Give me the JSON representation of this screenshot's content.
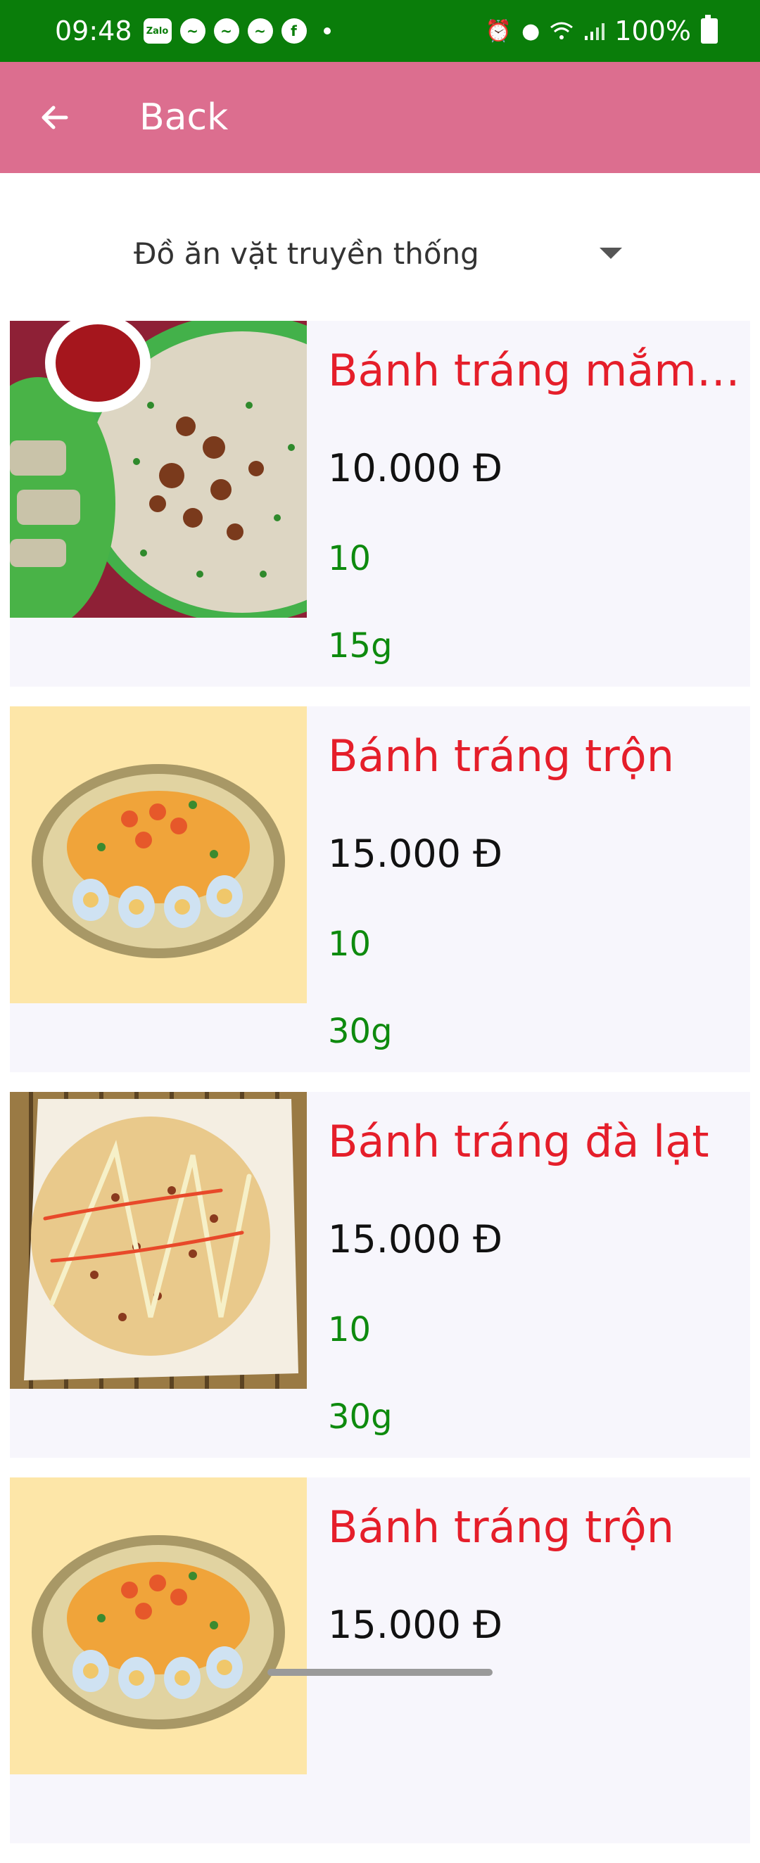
{
  "status_bar": {
    "time": "09:48",
    "notification_icons": [
      "zalo-icon",
      "messenger-icon",
      "messenger-icon",
      "messenger-icon",
      "facebook-icon",
      "more-dot-icon"
    ],
    "zalo_label": "Zalo",
    "right_icons": [
      "alarm-icon",
      "location-icon",
      "wifi-icon",
      "signal-icon",
      "battery-icon"
    ],
    "battery": "100%"
  },
  "app_bar": {
    "back_label": "Back",
    "color": "#dc6e8f"
  },
  "category_dropdown": {
    "selected": "Đồ ăn vặt truyền thống"
  },
  "products": [
    {
      "name": "Bánh tráng mắm r...",
      "price": "10.000 Đ",
      "quantity": "10",
      "weight": "15g",
      "image": "banh-trang-mam-ruoc-photo"
    },
    {
      "name": "Bánh tráng trộn",
      "price": "15.000 Đ",
      "quantity": "10",
      "weight": "30g",
      "image": "banh-trang-tron-photo"
    },
    {
      "name": "Bánh tráng đà lạt",
      "price": "15.000 Đ",
      "quantity": "10",
      "weight": "30g",
      "image": "banh-trang-da-lat-photo"
    },
    {
      "name": "Bánh tráng trộn",
      "price": "15.000 Đ",
      "quantity": "",
      "weight": "",
      "image": "banh-trang-tron-photo"
    }
  ],
  "colors": {
    "status_bar": "#0a7d0a",
    "product_name": "#e51e2a",
    "quantity_weight": "#0e8a0e",
    "card_background": "#f7f6fc"
  }
}
